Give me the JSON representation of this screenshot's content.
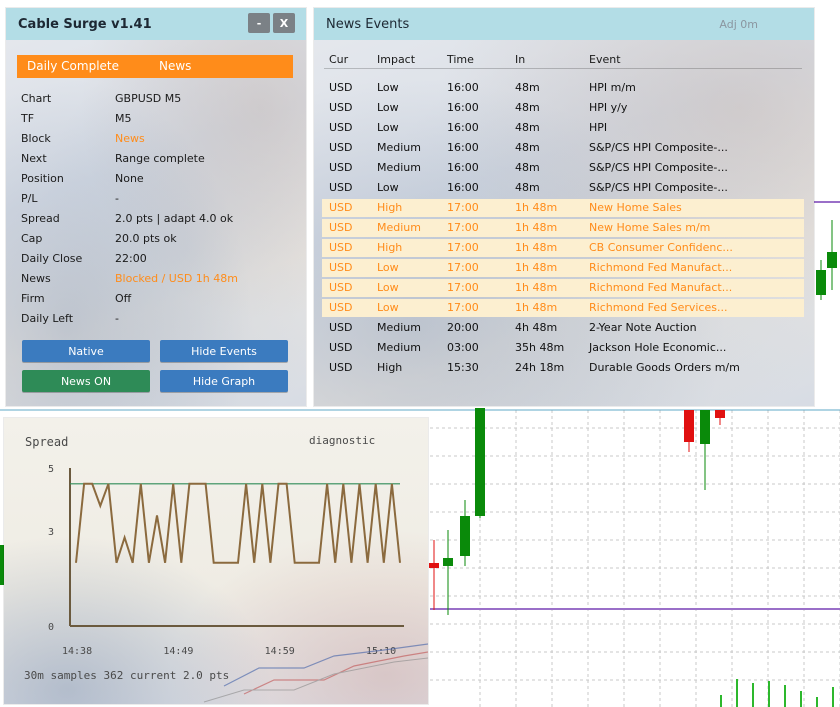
{
  "cable_surge": {
    "title": "Cable Surge v1.41",
    "minimize_label": "-",
    "close_label": "X",
    "status_left": "Daily Complete",
    "status_right": "News",
    "rows": [
      {
        "key": "Chart",
        "value": "GBPUSD M5",
        "highlight": false
      },
      {
        "key": "TF",
        "value": "M5",
        "highlight": false
      },
      {
        "key": "Block",
        "value": "News",
        "highlight": true
      },
      {
        "key": "Next",
        "value": "Range complete",
        "highlight": false
      },
      {
        "key": "Position",
        "value": "None",
        "highlight": false
      },
      {
        "key": "P/L",
        "value": "-",
        "highlight": false
      },
      {
        "key": "Spread",
        "value": "2.0 pts | adapt 4.0 ok",
        "highlight": false
      },
      {
        "key": "Cap",
        "value": "20.0 pts ok",
        "highlight": false
      },
      {
        "key": "Daily Close",
        "value": "22:00",
        "highlight": false
      },
      {
        "key": "News",
        "value": "Blocked / USD 1h 48m",
        "highlight": true
      },
      {
        "key": "Firm",
        "value": "Off",
        "highlight": false
      },
      {
        "key": "Daily Left",
        "value": "-",
        "highlight": false
      }
    ],
    "buttons": {
      "native": "Native",
      "hide_events": "Hide Events",
      "news_on": "News ON",
      "hide_graph": "Hide Graph"
    }
  },
  "news_events": {
    "title": "News Events",
    "adjust": "Adj 0m",
    "columns": [
      "Cur",
      "Impact",
      "Time",
      "In",
      "Event"
    ],
    "events": [
      {
        "cur": "USD",
        "impact": "Low",
        "time": "16:00",
        "in": "48m",
        "event": "HPI m/m",
        "highlight": false
      },
      {
        "cur": "USD",
        "impact": "Low",
        "time": "16:00",
        "in": "48m",
        "event": "HPI y/y",
        "highlight": false
      },
      {
        "cur": "USD",
        "impact": "Low",
        "time": "16:00",
        "in": "48m",
        "event": "HPI",
        "highlight": false
      },
      {
        "cur": "USD",
        "impact": "Medium",
        "time": "16:00",
        "in": "48m",
        "event": "S&P/CS HPI Composite-...",
        "highlight": false
      },
      {
        "cur": "USD",
        "impact": "Medium",
        "time": "16:00",
        "in": "48m",
        "event": "S&P/CS HPI Composite-...",
        "highlight": false
      },
      {
        "cur": "USD",
        "impact": "Low",
        "time": "16:00",
        "in": "48m",
        "event": "S&P/CS HPI Composite-...",
        "highlight": false
      },
      {
        "cur": "USD",
        "impact": "High",
        "time": "17:00",
        "in": "1h 48m",
        "event": "New Home Sales",
        "highlight": true
      },
      {
        "cur": "USD",
        "impact": "Medium",
        "time": "17:00",
        "in": "1h 48m",
        "event": "New Home Sales m/m",
        "highlight": true
      },
      {
        "cur": "USD",
        "impact": "High",
        "time": "17:00",
        "in": "1h 48m",
        "event": "CB Consumer Confidenc...",
        "highlight": true
      },
      {
        "cur": "USD",
        "impact": "Low",
        "time": "17:00",
        "in": "1h 48m",
        "event": "Richmond Fed Manufact...",
        "highlight": true
      },
      {
        "cur": "USD",
        "impact": "Low",
        "time": "17:00",
        "in": "1h 48m",
        "event": "Richmond Fed Manufact...",
        "highlight": true
      },
      {
        "cur": "USD",
        "impact": "Low",
        "time": "17:00",
        "in": "1h 48m",
        "event": "Richmond Fed Services...",
        "highlight": true
      },
      {
        "cur": "USD",
        "impact": "Medium",
        "time": "20:00",
        "in": "4h 48m",
        "event": "2-Year Note Auction",
        "highlight": false
      },
      {
        "cur": "USD",
        "impact": "Medium",
        "time": "03:00",
        "in": "35h 48m",
        "event": "Jackson Hole Economic...",
        "highlight": false
      },
      {
        "cur": "USD",
        "impact": "High",
        "time": "15:30",
        "in": "24h 18m",
        "event": "Durable Goods Orders m/m",
        "highlight": false
      }
    ]
  },
  "spread_graph": {
    "title": "Spread",
    "mode": "diagnostic",
    "footer": "30m samples 362   current 2.0 pts",
    "colors": {
      "line": "#8b6a3e",
      "threshold": "#2e8b57",
      "axis": "#6b5a3e"
    }
  },
  "chart_data": {
    "type": "line",
    "title": "Spread",
    "x_ticks": [
      "14:38",
      "14:49",
      "14:59",
      "15:10"
    ],
    "y_ticks": [
      0,
      3,
      5
    ],
    "ylim": [
      0,
      5
    ],
    "threshold": 4.5,
    "series": [
      {
        "values": [
          2,
          4.5,
          4.5,
          3.8,
          4.5,
          2,
          2.8,
          2,
          4.5,
          2,
          3.5,
          2,
          4.5,
          2,
          4.5,
          4.5,
          4.5,
          2,
          2,
          2,
          2,
          4.5,
          2,
          4.5,
          2,
          4.5,
          4.5,
          2,
          2,
          2,
          2,
          4.5,
          2,
          4.5,
          2,
          4.5,
          2,
          4.5,
          2,
          4.5,
          2
        ]
      }
    ]
  }
}
